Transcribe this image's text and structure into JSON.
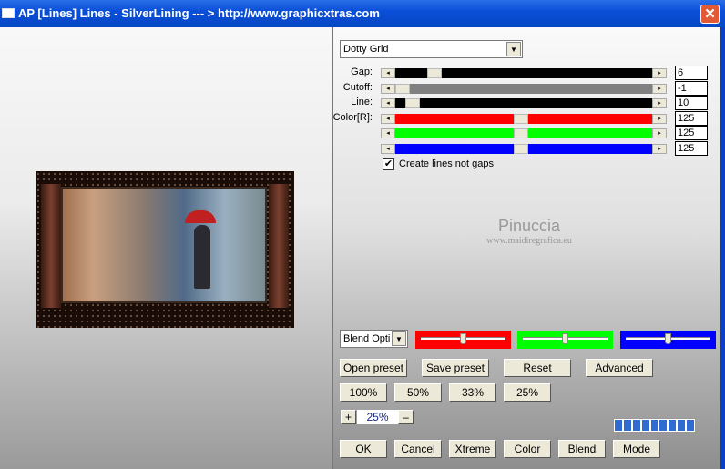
{
  "window": {
    "title": "AP [Lines]  Lines - SilverLining       --- > http://www.graphicxtras.com",
    "close": "✕"
  },
  "watermark": {
    "name": "Pinuccia",
    "url": "www.maidiregrafica.eu"
  },
  "preset_select": {
    "value": "Dotty Grid"
  },
  "sliders": [
    {
      "label": "Gap:",
      "value": "6",
      "position": 0.13,
      "track_color": "#000000"
    },
    {
      "label": "Cutoff:",
      "value": "-1",
      "position": 0.0,
      "track_color": "#808080"
    },
    {
      "label": "Line:",
      "value": "10",
      "position": 0.04,
      "track_color": "#000000"
    },
    {
      "label": "Color[R]:",
      "value": "125",
      "position": 0.49,
      "track_color": "#ff0000"
    },
    {
      "label": "",
      "value": "125",
      "position": 0.49,
      "track_color": "#00ff00"
    },
    {
      "label": "",
      "value": "125",
      "position": 0.49,
      "track_color": "#0000ff"
    }
  ],
  "checkbox": {
    "label": "Create lines not gaps",
    "checked": true
  },
  "blend_select": {
    "value": "Blend Opti"
  },
  "blend_sliders": [
    {
      "color": "#ff0000",
      "position": 0.5
    },
    {
      "color": "#00ff00",
      "position": 0.5
    },
    {
      "color": "#0000ff",
      "position": 0.5
    }
  ],
  "buttons_row1": [
    "Open preset",
    "Save preset",
    "Reset",
    "Advanced"
  ],
  "zoom_buttons": [
    "100%",
    "50%",
    "33%",
    "25%"
  ],
  "zoom": {
    "plus": "+",
    "value": "25%",
    "minus": "–"
  },
  "progress_segments": 9,
  "buttons_bottom": [
    "OK",
    "Cancel",
    "Xtreme",
    "Color",
    "Blend",
    "Mode"
  ]
}
